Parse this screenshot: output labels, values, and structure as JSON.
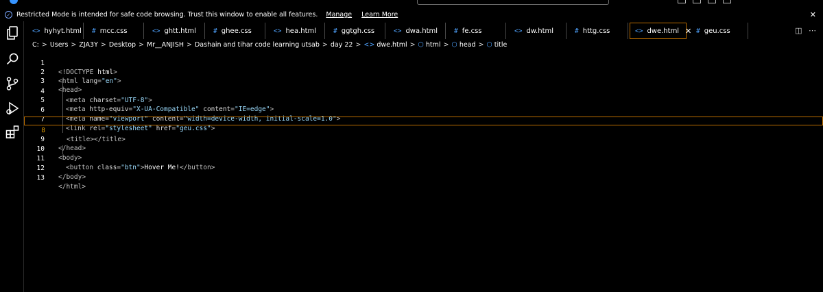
{
  "banner": {
    "message": "Restricted Mode is intended for safe code browsing. Trust this window to enable all features.",
    "manage_label": "Manage",
    "learn_more_label": "Learn More"
  },
  "tabs": [
    {
      "label": "hyhyt.html",
      "type": "html"
    },
    {
      "label": "mcc.css",
      "type": "css"
    },
    {
      "label": "ghtt.html",
      "type": "html"
    },
    {
      "label": "ghee.css",
      "type": "css"
    },
    {
      "label": "hea.html",
      "type": "html"
    },
    {
      "label": "ggtgh.css",
      "type": "css"
    },
    {
      "label": "dwa.html",
      "type": "html"
    },
    {
      "label": "fe.css",
      "type": "css"
    },
    {
      "label": "dw.html",
      "type": "html"
    },
    {
      "label": "httg.css",
      "type": "css"
    },
    {
      "label": "dwe.html",
      "type": "html",
      "active": true
    },
    {
      "label": "geu.css",
      "type": "css"
    }
  ],
  "icons": {
    "html": "<>",
    "css": "#",
    "close": "✕",
    "chevron": ">"
  },
  "breadcrumb": [
    "C:",
    "Users",
    "ZJA3Y",
    "Desktop",
    "Mr__ANJISH",
    "Dashain and tihar code learning utsab",
    "day 22",
    "dwe.html",
    "html",
    "head",
    "title"
  ],
  "editor": {
    "current_line": 8,
    "lines": [
      {
        "n": "1"
      },
      {
        "n": "2"
      },
      {
        "n": "3"
      },
      {
        "n": "4"
      },
      {
        "n": "5"
      },
      {
        "n": "6"
      },
      {
        "n": "7"
      },
      {
        "n": "8"
      },
      {
        "n": "9"
      },
      {
        "n": "10"
      },
      {
        "n": "11"
      },
      {
        "n": "12"
      },
      {
        "n": "13"
      }
    ],
    "code": {
      "l1": {
        "open": "<!",
        "kw": "DOCTYPE",
        "name": " html",
        "close": ">"
      },
      "l2": {
        "open": "<",
        "tag": "html",
        "attr": " lang",
        "eq": "=",
        "val": "\"en\"",
        "close": ">"
      },
      "l3": {
        "text": "<head>"
      },
      "l4": {
        "tag": "<meta",
        "attr": " charset",
        "eq": "=",
        "val": "\"UTF-8\"",
        "close": ">"
      },
      "l5": {
        "tag": "<meta",
        "attr1": " http-equiv",
        "val1": "\"X-UA-Compatible\"",
        "attr2": " content",
        "val2": "\"IE=edge\"",
        "close": ">"
      },
      "l6": {
        "tag": "<meta",
        "attr1": " name",
        "val1": "\"viewport\"",
        "attr2": " content",
        "val2": "\"width=device-width, initial-scale=1.0\"",
        "close": ">"
      },
      "l7": {
        "tag": "<link",
        "attr1": " rel",
        "val1": "\"stylesheet\"",
        "attr2": " href",
        "val2": "\"geu.css\"",
        "close": ">"
      },
      "l8": {
        "text": "<title></title>"
      },
      "l9": {
        "text": "</head>"
      },
      "l10": {
        "text": "<body>"
      },
      "l11": {
        "tag": "<button",
        "attr": " class",
        "eq": "=",
        "val": "\"btn\"",
        "close": ">",
        "content": "Hover Me!",
        "end": "</button>"
      },
      "l12": {
        "text": "</body>"
      },
      "l13": {
        "text": "</html>"
      }
    }
  }
}
